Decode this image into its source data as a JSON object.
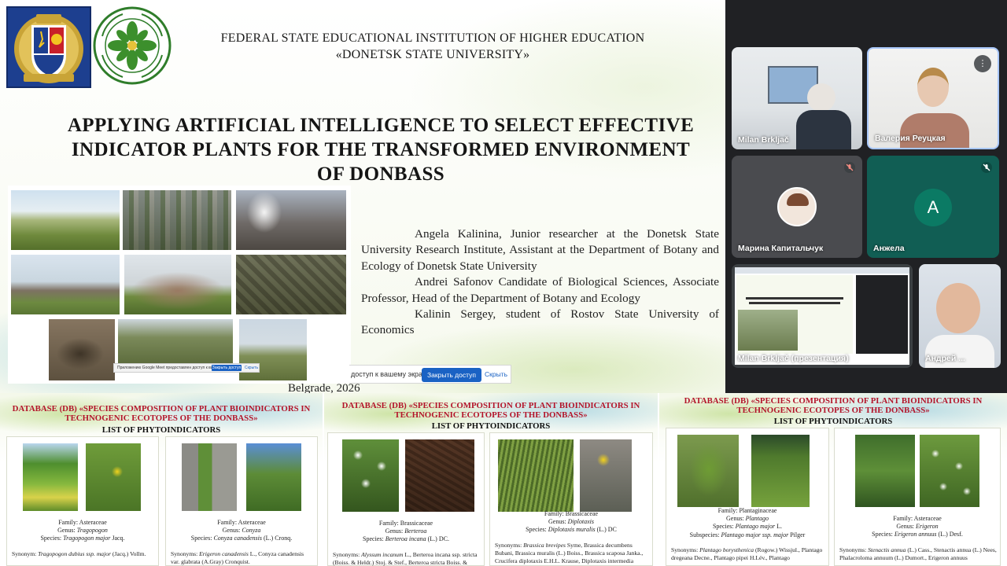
{
  "main_slide": {
    "institution_line1": "FEDERAL STATE EDUCATIONAL INSTITUTION OF HIGHER EDUCATION",
    "institution_line2": "«DONETSK STATE UNIVERSITY»",
    "title_lines": [
      "APPLYING ARTIFICIAL INTELLIGENCE TO SELECT EFFECTIVE",
      "INDICATOR PLANTS FOR THE TRANSFORMED ENVIRONMENT",
      "OF DONBASS"
    ],
    "authors": [
      "Angela Kalinina, Junior researcher at the Donetsk State University Research Institute, Assistant at the Department of Botany and Ecology of Donetsk State University",
      "Andrei Safonov Candidate of Biological Sciences, Associate Professor, Head of the Department of Botany and Ecology",
      "Kalinin Sergey, student of Rostov State University of Economics"
    ],
    "footer": "Belgrade, 2026",
    "share_bar": {
      "text": "доступ к вашему экрану.",
      "stop_button": "Закрыть доступ",
      "hide_link": "Скрыть"
    },
    "mini_share_bar": {
      "text": "Приложению Google Meet предоставлен доступ к вашему экрану.",
      "stop_button": "Закрыть доступ",
      "hide_link": "Скрыть"
    }
  },
  "participants": [
    {
      "name": "Milan Brkljač",
      "muted": false
    },
    {
      "name": "Валерия Реуцкая",
      "muted": false
    },
    {
      "name": "Марина Капитальчук",
      "muted": true
    },
    {
      "name": "Анжела",
      "muted": true,
      "avatar_letter": "A",
      "avatar_color": "#0b7a64"
    },
    {
      "name": "Milan Brkljač (презентация)",
      "muted": false
    },
    {
      "name": "Андрей ...",
      "muted": false
    }
  ],
  "db_slides": [
    {
      "title_line1": "DATABASE (DB) «SPECIES COMPOSITION OF PLANT BIOINDICATORS IN",
      "title_line2": "TECHNOGENIC ECOTOPES OF THE DONBASS»",
      "subtitle": "LIST OF PHYTOINDICATORS",
      "cards": [
        {
          "family": "Family: Asteraceae",
          "genus_label": "Genus:",
          "genus": "Tragopogon",
          "species_label": "Species:",
          "species": "Tragopogon major",
          "species_author": "Jacq.",
          "syn_label": "Synonym:",
          "syn_name": "Tragopogon dubius ssp. major",
          "syn_rest": "(Jacq.) Vollm."
        },
        {
          "family": "Family: Asteraceae",
          "genus_label": "Genus:",
          "genus": "Conyza",
          "species_label": "Species:",
          "species": "Conyza canadensis",
          "species_author": "(L.) Cronq.",
          "syn_label": "Synonyms:",
          "syn_name": "Erigeron canadensis",
          "syn_rest": "L., Conyza canadensis var. glabrata (A.Gray) Cronquist."
        }
      ]
    },
    {
      "title_line1": "DATABASE (DB) «SPECIES COMPOSITION OF PLANT BIOINDICATORS IN",
      "title_line2": "TECHNOGENIC ECOTOPES OF THE DONBASS»",
      "subtitle": "LIST OF PHYTOINDICATORS",
      "cards": [
        {
          "family": "Family: Brassicaceae",
          "genus_label": "Genus:",
          "genus": "Berteroa",
          "species_label": "Species:",
          "species": "Berteroa incana",
          "species_author": "(L.) DC.",
          "syn_label": "Synonyms:",
          "syn_name": "Alyssum incanum",
          "syn_rest": "L., Berteroa incana ssp. stricta (Boiss. & Heldr.) Stoj. & Stef., Berteroa stricta Boiss. &"
        },
        {
          "family": "Family: Brassicaceae",
          "genus_label": "Genus:",
          "genus": "Diplotaxis",
          "species_label": "Species:",
          "species": "Diplotaxis muralis",
          "species_author": "(L.) DC",
          "syn_label": "Synonyms:",
          "syn_name": "Brassica brevipes",
          "syn_rest": "Syme, Brassica decumbens Bubani, Brassica muralis (L.) Boiss., Brassica scaposa Janka., Crucifera diplotaxis E.H.L. Krause, Diplotaxis intermedia"
        }
      ]
    },
    {
      "title_line1": "DATABASE (DB) «SPECIES COMPOSITION OF PLANT BIOINDICATORS IN",
      "title_line2": "TECHNOGENIC ECOTOPES OF THE DONBASS»",
      "subtitle": "LIST OF PHYTOINDICATORS",
      "cards": [
        {
          "family": "Family: Plantaginaceae",
          "genus_label": "Genus:",
          "genus": "Plantago",
          "species_label": "Species:",
          "species": "Plantago major",
          "species_author": "L.",
          "subspecies_label": "Subspecies:",
          "subspecies": "Plantago major ssp. major",
          "subspecies_author": "Pilger",
          "syn_label": "Synonyms:",
          "syn_name": "Plantago borysthenica",
          "syn_rest": "(Rogow.) Wissjul., Plantago dregeana Decne., Plantago pipei H.Lév., Plantago"
        },
        {
          "family": "Family: Asteraceae",
          "genus_label": "Genus:",
          "genus": "Erigeron",
          "species_label": "Species:",
          "species": "Erigeron annuus",
          "species_author": "(L.) Desf.",
          "syn_label": "Synonyms:",
          "syn_name": "Stenactis annua",
          "syn_rest": "(L.) Cass., Stenactis annua (L.) Nees, Phalacroloma annuum (L.) Dumort., Erigeron annuus"
        }
      ]
    }
  ]
}
